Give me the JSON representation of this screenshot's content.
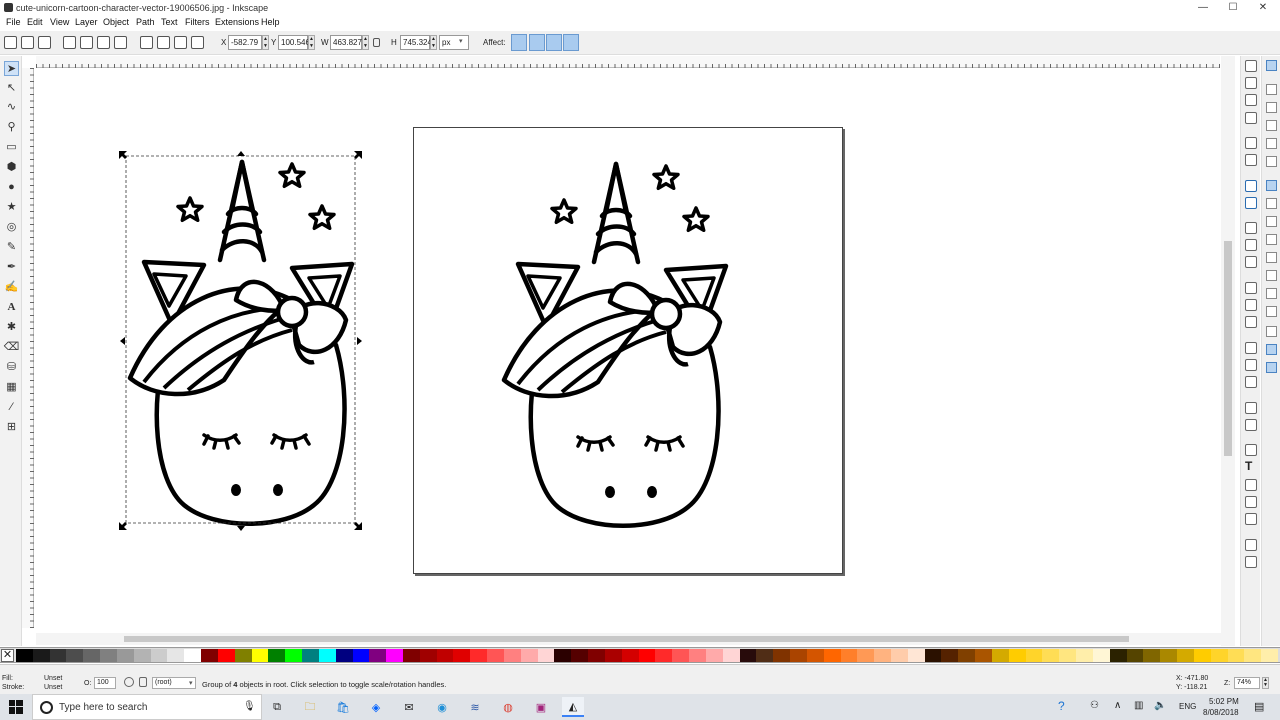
{
  "window": {
    "title": "cute-unicorn-cartoon-character-vector-19006506.jpg - Inkscape",
    "minimize": "—",
    "maximize": "☐",
    "close": "✕"
  },
  "menu": [
    "File",
    "Edit",
    "View",
    "Layer",
    "Object",
    "Path",
    "Text",
    "Filters",
    "Extensions",
    "Help"
  ],
  "controls": {
    "x_label": "X",
    "x_value": "-582.79",
    "y_label": "Y",
    "y_value": "100.546",
    "w_label": "W",
    "w_value": "463.827",
    "h_label": "H",
    "h_value": "745.324",
    "unit": "px",
    "affect_label": "Affect:"
  },
  "status": {
    "fill_label": "Fill:",
    "fill_value": "Unset",
    "stroke_label": "Stroke:",
    "stroke_value": "Unset",
    "opacity_label": "O:",
    "opacity_value": "100",
    "layer_value": "(root)",
    "message_pre": "Group of ",
    "message_count": "4",
    "message_post": " objects in root. Click selection to toggle scale/rotation handles.",
    "cursor_x": "X: -471.80",
    "cursor_y": "Y: -118.21",
    "zoom_label": "Z:",
    "zoom_value": "74%"
  },
  "taskbar": {
    "search_placeholder": "Type here to search",
    "language": "ENG",
    "time": "5:02 PM",
    "date": "8/08/2018"
  },
  "palette_colors": [
    "#000000",
    "#1a1a1a",
    "#333333",
    "#4d4d4d",
    "#666666",
    "#808080",
    "#999999",
    "#b3b3b3",
    "#cccccc",
    "#e6e6e6",
    "#ffffff",
    "#800000",
    "#ff0000",
    "#808000",
    "#ffff00",
    "#008000",
    "#00ff00",
    "#008080",
    "#00ffff",
    "#000080",
    "#0000ff",
    "#800080",
    "#ff00ff",
    "#7f0000",
    "#a00000",
    "#c00000",
    "#e00000",
    "#ff2a2a",
    "#ff5555",
    "#ff8080",
    "#ffaaaa",
    "#ffd5d5",
    "#2b0000",
    "#550000",
    "#800000",
    "#aa0000",
    "#d40000",
    "#ff0000",
    "#ff2a2a",
    "#ff5555",
    "#ff8080",
    "#ffaaaa",
    "#ffd5d5",
    "#280b0b",
    "#502d16",
    "#803300",
    "#aa4400",
    "#d45500",
    "#ff6600",
    "#ff7f2a",
    "#ff9955",
    "#ffb380",
    "#ffccaa",
    "#ffe6d5",
    "#2b1100",
    "#552200",
    "#804000",
    "#aa5500",
    "#d4aa00",
    "#ffcc00",
    "#ffd42a",
    "#ffdd55",
    "#ffe680",
    "#ffeeaa",
    "#fff6d5",
    "#2b2200",
    "#554400",
    "#806600",
    "#aa8800",
    "#d4aa00",
    "#ffcc00",
    "#ffd42a",
    "#ffdd55",
    "#ffe680",
    "#ffeeaa"
  ]
}
